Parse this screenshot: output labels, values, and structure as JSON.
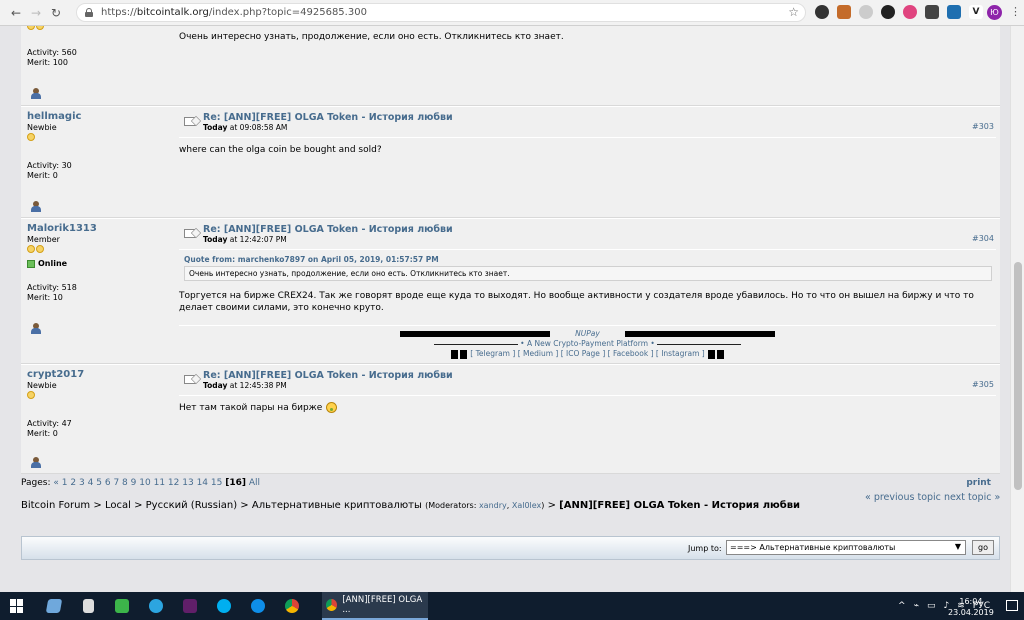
{
  "browser": {
    "url_prefix": "https://",
    "url_host": "bitcointalk.org",
    "url_path": "/index.php?topic=4925685.300",
    "profile_initial": "Ю"
  },
  "posts": [
    {
      "username": "",
      "rank": "",
      "activity": "Activity: 560",
      "merit": "Merit: 100",
      "body": "Очень интересно узнать, продолжение, если оно есть. Откликнитесь кто знает."
    },
    {
      "username": "hellmagic",
      "rank": "Newbie",
      "activity": "Activity: 30",
      "merit": "Merit: 0",
      "subject": "Re: [ANN][FREE] OLGA Token - История любви",
      "date_prefix": "Today",
      "date_time": " at 09:08:58 AM",
      "number": "#303",
      "body": "where can the olga coin be bought and sold?"
    },
    {
      "username": "Malorik1313",
      "rank": "Member",
      "online": "Online",
      "activity": "Activity: 518",
      "merit": "Merit: 10",
      "subject": "Re: [ANN][FREE] OLGA Token - История любви",
      "date_prefix": "Today",
      "date_time": " at 12:42:07 PM",
      "number": "#304",
      "quote_header": "Quote from: marchenko7897 on April 05, 2019, 01:57:57 PM",
      "quote_text": "Очень интересно узнать, продолжение, если оно есть. Откликнитесь кто знает.",
      "body": "Торгуется на бирже CREX24. Так же говорят вроде еще куда то выходят. Но вообще активности у создателя вроде убавилось. Но то что он вышел на биржу и что то делает своими силами, это конечно круто.",
      "sig": {
        "brand": "NUPay",
        "tagline": "A New Crypto-Payment Platform",
        "links": [
          "Telegram",
          "Medium",
          "ICO Page",
          "Facebook",
          "Instagram"
        ]
      }
    },
    {
      "username": "crypt2017",
      "rank": "Newbie",
      "activity": "Activity: 47",
      "merit": "Merit: 0",
      "subject": "Re: [ANN][FREE] OLGA Token - История любви",
      "date_prefix": "Today",
      "date_time": " at 12:45:38 PM",
      "number": "#305",
      "body": "Нет там такой пары на бирже"
    }
  ],
  "pagination": {
    "label": "Pages:",
    "prev": "«",
    "pages": [
      "1",
      "2",
      "3",
      "4",
      "5",
      "6",
      "7",
      "8",
      "9",
      "10",
      "11",
      "12",
      "13",
      "14",
      "15"
    ],
    "current": "16",
    "all": "All",
    "print": "print"
  },
  "topic_nav": {
    "prev": "« previous topic",
    "next": "next topic »"
  },
  "breadcrumb": {
    "items": [
      "Bitcoin Forum",
      "Local",
      "Русский (Russian)",
      "Альтернативные криптовалюты"
    ],
    "moderators_label": "(Moderators: ",
    "moderators": [
      "xandry",
      "Xal0lex"
    ],
    "moderators_end": ")",
    "sep": ">",
    "current": "[ANN][FREE] OLGA Token - История любви"
  },
  "jump": {
    "label": "Jump to:",
    "selected": "===> Альтернативные криптовалюты",
    "go": "go"
  },
  "taskbar": {
    "active_window": "[ANN][FREE] OLGA ...",
    "lang": "РУС",
    "time": "16:04",
    "date": "23.04.2019"
  }
}
